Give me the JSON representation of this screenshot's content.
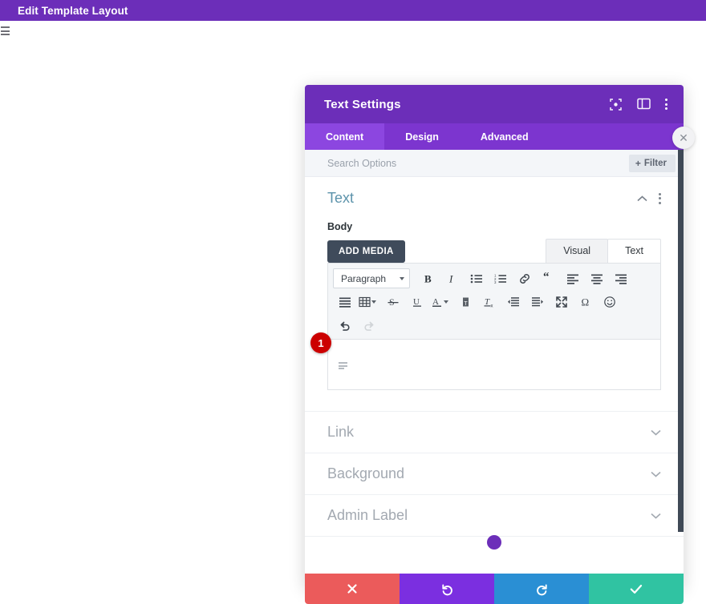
{
  "admin_bar": {
    "title": "Edit Template Layout"
  },
  "page": {
    "menu_icon": "hamburger-icon"
  },
  "modal": {
    "title": "Text Settings",
    "header_icons": [
      {
        "name": "focus-target-icon"
      },
      {
        "name": "split-view-icon"
      },
      {
        "name": "more-options-icon"
      }
    ],
    "close_label": "✕",
    "tabs": [
      {
        "label": "Content",
        "active": true
      },
      {
        "label": "Design",
        "active": false
      },
      {
        "label": "Advanced",
        "active": false
      }
    ],
    "search": {
      "placeholder": "Search Options",
      "value": ""
    },
    "filter_button": {
      "plus": "+",
      "label": "Filter"
    },
    "open_section": {
      "title": "Text",
      "collapse_icon": "chevron-up-icon",
      "menu_icon": "more-options-icon"
    },
    "body_field": {
      "label": "Body",
      "add_media_label": "ADD MEDIA",
      "editor_tabs": [
        {
          "label": "Visual",
          "active": false
        },
        {
          "label": "Text",
          "active": true
        }
      ],
      "content": ""
    },
    "toolbar": {
      "format_select": {
        "value": "Paragraph"
      },
      "row1": [
        {
          "name": "bold-icon",
          "label": "B"
        },
        {
          "name": "italic-icon",
          "label": "I"
        },
        {
          "name": "bulleted-list-icon",
          "label": ""
        },
        {
          "name": "numbered-list-icon",
          "label": ""
        },
        {
          "name": "link-icon",
          "label": ""
        },
        {
          "name": "blockquote-icon",
          "label": "“"
        },
        {
          "name": "align-left-icon",
          "label": ""
        },
        {
          "name": "align-center-icon",
          "label": ""
        },
        {
          "name": "align-right-icon",
          "label": ""
        }
      ],
      "row2": [
        {
          "name": "align-justify-icon"
        },
        {
          "name": "table-icon"
        },
        {
          "name": "strikethrough-icon"
        },
        {
          "name": "underline-icon"
        },
        {
          "name": "text-color-icon"
        },
        {
          "name": "paste-as-text-icon"
        },
        {
          "name": "clear-formatting-icon"
        },
        {
          "name": "outdent-icon"
        },
        {
          "name": "indent-icon"
        },
        {
          "name": "fullscreen-icon"
        },
        {
          "name": "special-character-icon"
        },
        {
          "name": "emoji-icon"
        }
      ],
      "row3": [
        {
          "name": "undo-icon",
          "disabled": false
        },
        {
          "name": "redo-icon",
          "disabled": true
        }
      ]
    },
    "step_badge": "1",
    "collapsed_sections": [
      {
        "title": "Link",
        "icon": "chevron-down-icon"
      },
      {
        "title": "Background",
        "icon": "chevron-down-icon"
      },
      {
        "title": "Admin Label",
        "icon": "chevron-down-icon"
      }
    ],
    "footer_buttons": [
      {
        "name": "cancel-button",
        "icon": "close-icon",
        "color": "#eb5b5b"
      },
      {
        "name": "undo-button",
        "icon": "undo-icon",
        "color": "#7b2fe0"
      },
      {
        "name": "redo-button",
        "icon": "redo-icon",
        "color": "#2a8fd4"
      },
      {
        "name": "save-button",
        "icon": "check-icon",
        "color": "#30c3a2"
      }
    ]
  },
  "colors": {
    "brand_purple": "#6c2eb9",
    "tab_purple": "#7c35cf",
    "tab_active_purple": "#8c46e0",
    "badge_red": "#cc0000",
    "section_title_blue": "#5c93ab"
  }
}
